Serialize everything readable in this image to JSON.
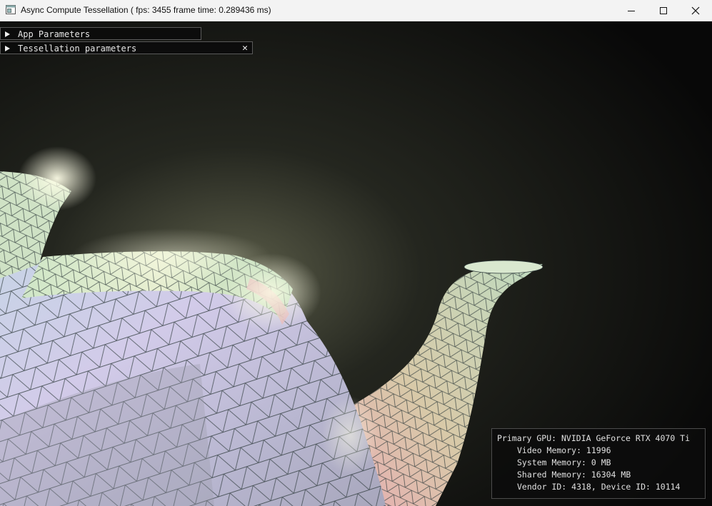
{
  "window": {
    "title": "Async Compute Tessellation ( fps: 3455 frame time: 0.289436 ms)",
    "icon": "app-window-icon",
    "controls": [
      "minimize-icon",
      "maximize-icon",
      "close-icon"
    ]
  },
  "panels": {
    "app_parameters": {
      "label": "App Parameters",
      "expanded": false
    },
    "tessellation_parameters": {
      "label": "Tessellation parameters",
      "expanded": false,
      "close_glyph": "✕"
    }
  },
  "gpu_info": {
    "primary_gpu": "Primary GPU: NVIDIA GeForce RTX 4070 Ti",
    "video_memory": "Video Memory: 11996",
    "system_memory": "System Memory: 0 MB",
    "shared_memory": "Shared Memory: 16304 MB",
    "ids": "Vendor ID: 4318, Device ID: 10114"
  },
  "scene": {
    "subject": "tessellated-teapot",
    "colors": {
      "background": "#0b0b0a",
      "wire": "#2e3a3a",
      "lilac": "#c9c3e6",
      "mint": "#c8e6c2",
      "pink": "#e6a6ae",
      "glow": "#fffbe0"
    }
  }
}
